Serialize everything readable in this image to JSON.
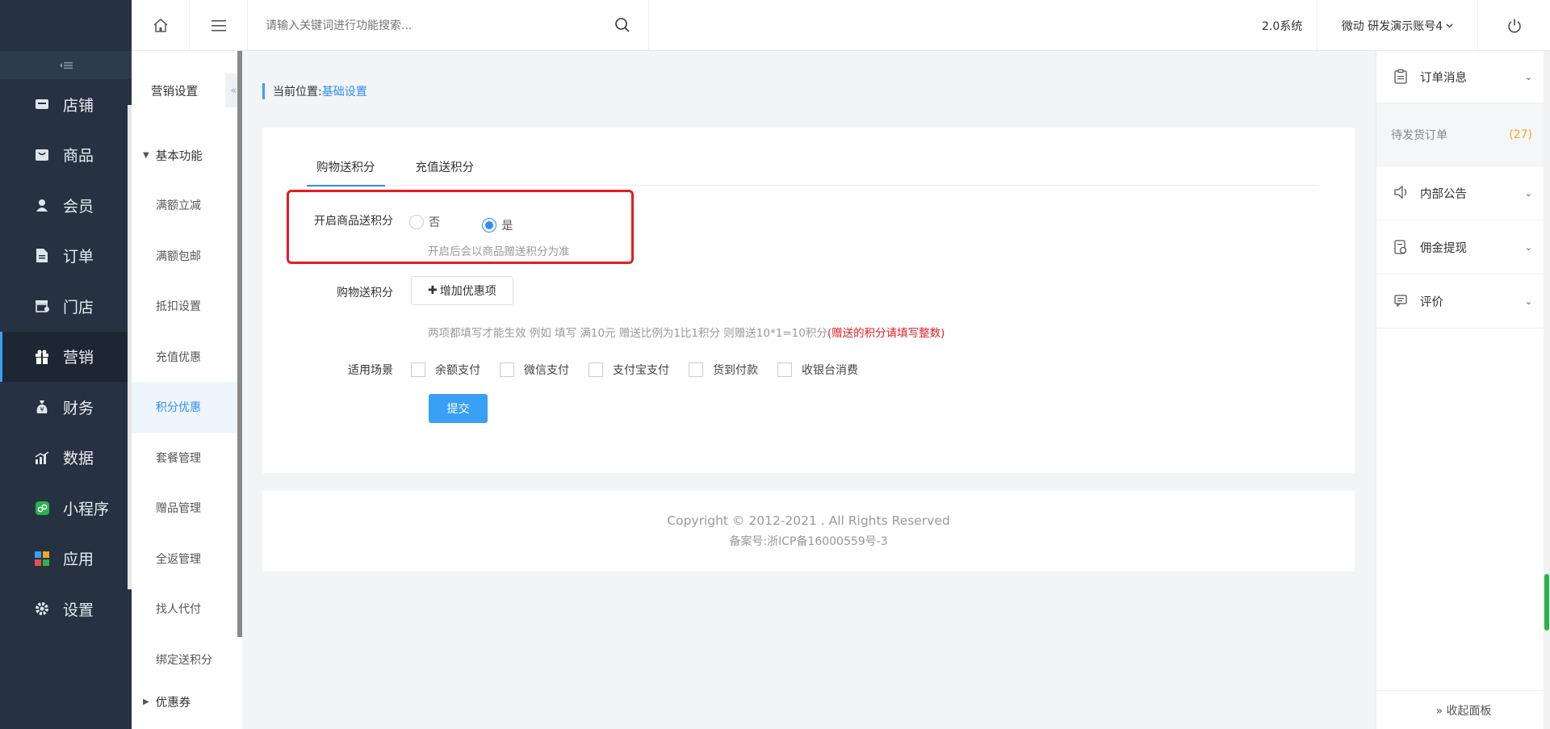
{
  "topbar": {
    "search_placeholder": "请输入关键词进行功能搜索...",
    "system_label": "2.0系统",
    "account_label": "微动 研发演示账号4"
  },
  "sidebar": {
    "items": [
      {
        "label": "店铺",
        "icon": "store-icon"
      },
      {
        "label": "商品",
        "icon": "bag-icon"
      },
      {
        "label": "会员",
        "icon": "user-icon"
      },
      {
        "label": "订单",
        "icon": "document-icon"
      },
      {
        "label": "门店",
        "icon": "shop-icon"
      },
      {
        "label": "营销",
        "icon": "gift-icon",
        "active": true
      },
      {
        "label": "财务",
        "icon": "moneybag-icon"
      },
      {
        "label": "数据",
        "icon": "chart-icon"
      },
      {
        "label": "小程序",
        "icon": "miniapp-icon"
      },
      {
        "label": "应用",
        "icon": "apps-icon"
      },
      {
        "label": "设置",
        "icon": "gear-icon"
      }
    ]
  },
  "subnav": {
    "title": "营销设置",
    "group_basic": "基本功能",
    "items": [
      "满额立减",
      "满额包邮",
      "抵扣设置",
      "充值优惠",
      "积分优惠",
      "套餐管理",
      "赠品管理",
      "全返管理",
      "找人代付",
      "绑定送积分"
    ],
    "active_index": 4,
    "group_coupon": "优惠券"
  },
  "breadcrumb": {
    "prefix": "当前位置:",
    "current": "基础设置"
  },
  "tabs": [
    "购物送积分",
    "充值送积分"
  ],
  "form": {
    "toggle_label": "开启商品送积分",
    "option_no": "否",
    "option_yes": "是",
    "toggle_hint": "开启后会以商品赠送积分为准",
    "shopping_label": "购物送积分",
    "add_button": "增加优惠项",
    "rule_hint": "两项都填写才能生效 例如 填写 满10元 赠送比例为1比1积分 则赠送10*1=10积分",
    "rule_warn": "(赠送的积分请填写整数)",
    "scene_label": "适用场景",
    "scenes": [
      "余额支付",
      "微信支付",
      "支付宝支付",
      "货到付款",
      "收银台消费"
    ],
    "submit": "提交"
  },
  "footer": {
    "copyright": "Copyright © 2012-2021 . All Rights Reserved",
    "icp": "备案号:浙ICP备16000559号-3"
  },
  "rpanel": {
    "order_msg": "订单消息",
    "pending_orders": "待发货订单",
    "pending_count": "(27)",
    "notice": "内部公告",
    "commission": "佣金提现",
    "review": "评价",
    "collapse": "» 收起面板"
  }
}
